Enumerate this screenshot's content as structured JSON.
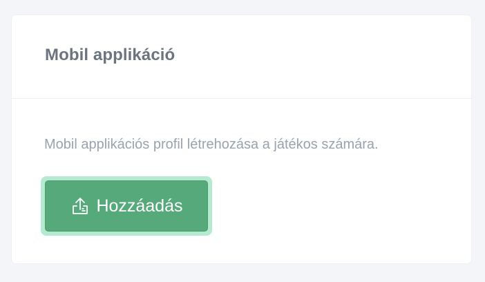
{
  "card": {
    "title": "Mobil applikáció",
    "description": "Mobil applikációs profil létrehozása a játékos számára.",
    "add_button": {
      "label": "Hozzáadás",
      "icon": "upload-icon"
    }
  },
  "colors": {
    "background": "#f4f5f8",
    "card": "#ffffff",
    "title": "#6c7480",
    "description": "#9aa2ad",
    "button": "#55a97a",
    "button_focus_ring": "#b5ead0",
    "button_text": "#ffffff"
  }
}
